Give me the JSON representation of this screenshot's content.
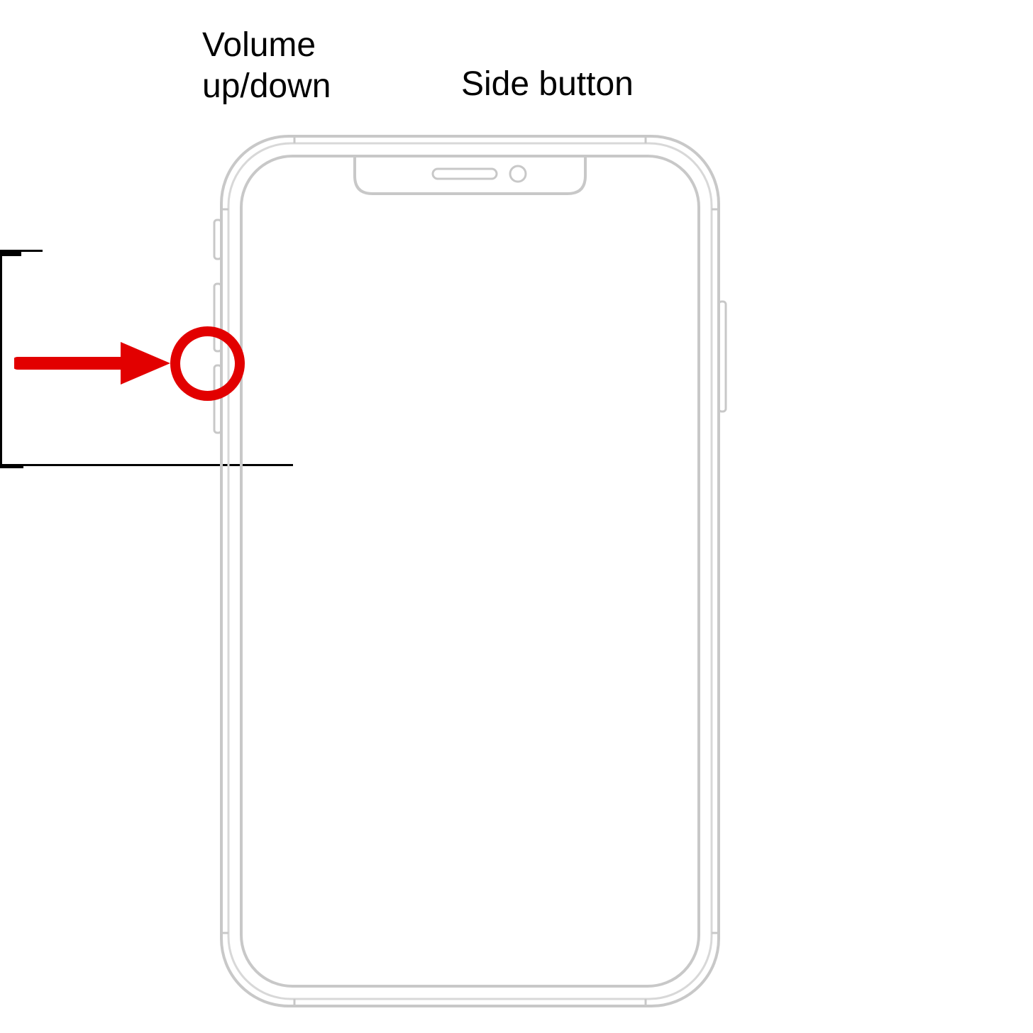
{
  "labels": {
    "volume": "Volume\nup/down",
    "side": "Side button"
  },
  "colors": {
    "highlight": "#e20000",
    "outline": "#c8c8c8",
    "text": "#000000"
  }
}
